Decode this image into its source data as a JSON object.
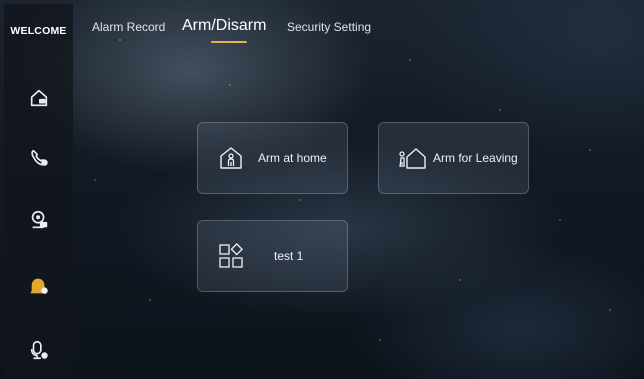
{
  "sidebar": {
    "brand": "WELCOME",
    "items": [
      {
        "name": "home",
        "icon": "home-icon"
      },
      {
        "name": "call",
        "icon": "phone-icon"
      },
      {
        "name": "monitor",
        "icon": "camera-icon"
      },
      {
        "name": "alarm",
        "icon": "alarm-icon",
        "active": true,
        "active_color": "#e3a92a"
      },
      {
        "name": "intercom",
        "icon": "intercom-icon"
      }
    ]
  },
  "tabs": [
    {
      "label": "Alarm Record"
    },
    {
      "label": "Arm/Disarm",
      "active": true
    },
    {
      "label": "Security Setting"
    }
  ],
  "accent_color": "#e3b24a",
  "modes": [
    {
      "label": "Arm at home",
      "icon": "person-in-house-icon"
    },
    {
      "label": "Arm for Leaving",
      "icon": "person-leaving-house-icon"
    },
    {
      "label": "test 1",
      "icon": "custom-mode-grid-icon"
    }
  ]
}
